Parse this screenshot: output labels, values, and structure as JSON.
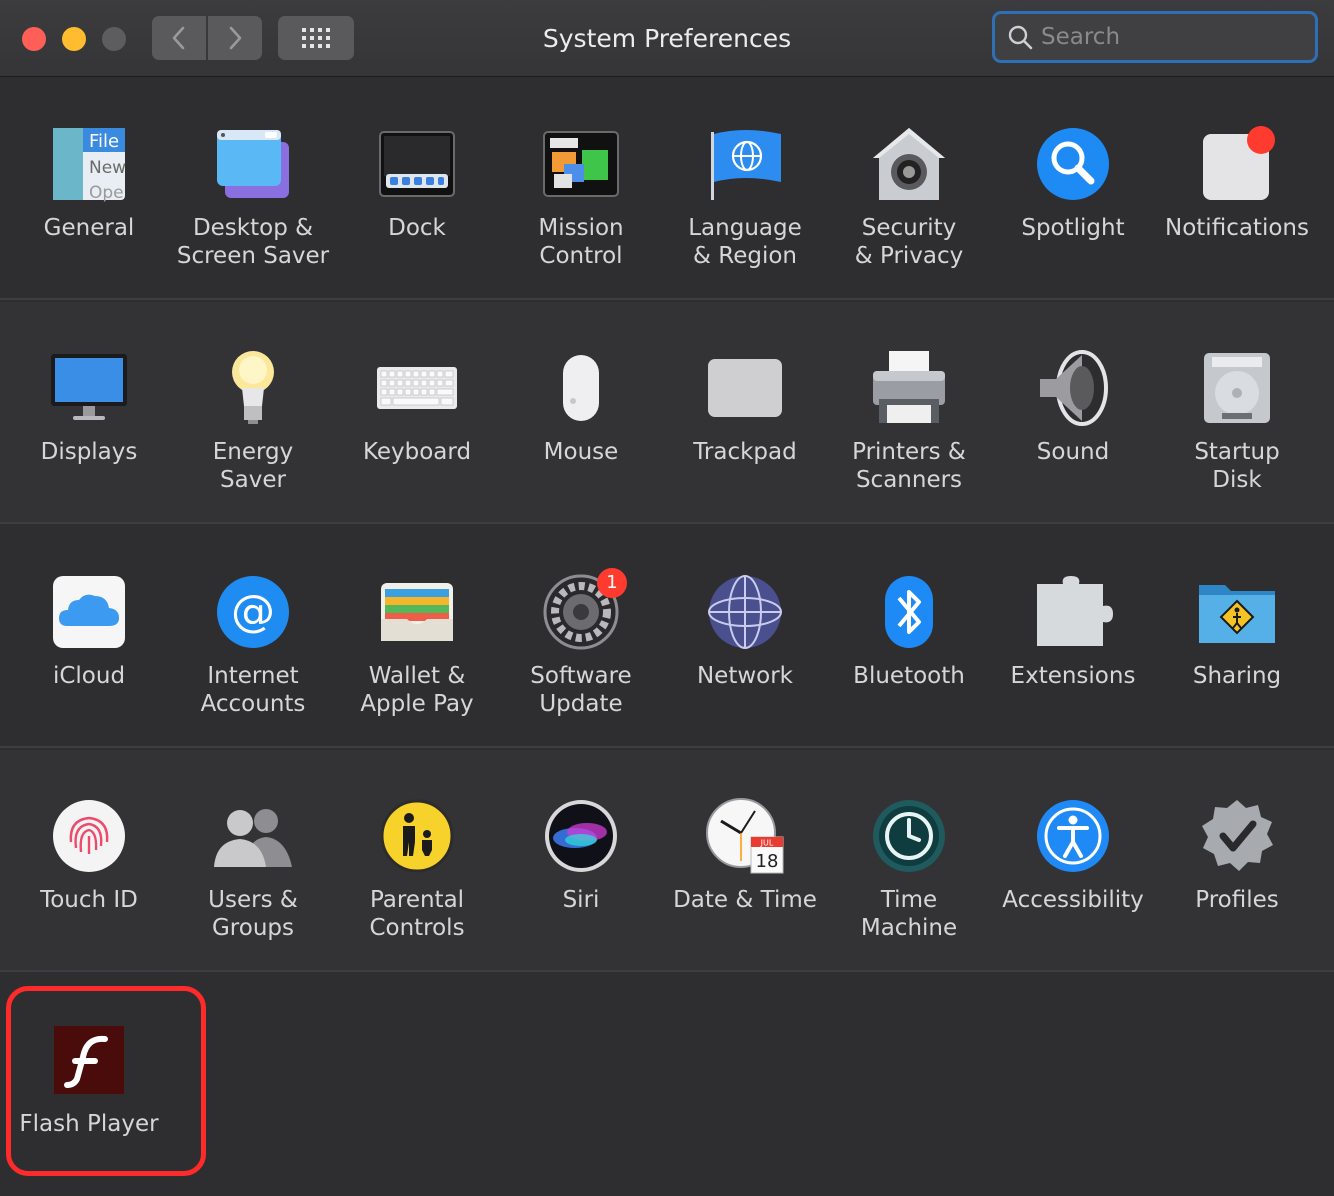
{
  "window": {
    "title": "System Preferences"
  },
  "search": {
    "placeholder": "Search",
    "value": ""
  },
  "toolbar": {
    "back_icon": "chevron-left-icon",
    "forward_icon": "chevron-right-icon",
    "grid_icon": "grid-icon"
  },
  "colors": {
    "close": "#ff5f57",
    "minimize": "#febc2e",
    "zoom": "#5d5d60",
    "highlight": "#ff2a2a",
    "accent": "#2f6fb6"
  },
  "rows": {
    "row1": [
      {
        "label": "General",
        "icon": "general-icon"
      },
      {
        "label": "Desktop &\nScreen Saver",
        "icon": "desktop-icon"
      },
      {
        "label": "Dock",
        "icon": "dock-icon"
      },
      {
        "label": "Mission\nControl",
        "icon": "mission-control-icon"
      },
      {
        "label": "Language\n& Region",
        "icon": "flag-icon"
      },
      {
        "label": "Security\n& Privacy",
        "icon": "house-lock-icon"
      },
      {
        "label": "Spotlight",
        "icon": "magnifier-icon"
      },
      {
        "label": "Notifications",
        "icon": "notifications-icon"
      }
    ],
    "row2": [
      {
        "label": "Displays",
        "icon": "monitor-icon"
      },
      {
        "label": "Energy\nSaver",
        "icon": "lightbulb-icon"
      },
      {
        "label": "Keyboard",
        "icon": "keyboard-icon"
      },
      {
        "label": "Mouse",
        "icon": "mouse-icon"
      },
      {
        "label": "Trackpad",
        "icon": "trackpad-icon"
      },
      {
        "label": "Printers &\nScanners",
        "icon": "printer-icon"
      },
      {
        "label": "Sound",
        "icon": "speaker-icon"
      },
      {
        "label": "Startup\nDisk",
        "icon": "harddisk-icon"
      }
    ],
    "row3": [
      {
        "label": "iCloud",
        "icon": "cloud-icon"
      },
      {
        "label": "Internet\nAccounts",
        "icon": "at-icon"
      },
      {
        "label": "Wallet &\nApple Pay",
        "icon": "wallet-icon"
      },
      {
        "label": "Software\nUpdate",
        "icon": "gear-icon",
        "badge": "1"
      },
      {
        "label": "Network",
        "icon": "globe-icon"
      },
      {
        "label": "Bluetooth",
        "icon": "bluetooth-icon"
      },
      {
        "label": "Extensions",
        "icon": "puzzle-icon"
      },
      {
        "label": "Sharing",
        "icon": "folder-sharing-icon"
      }
    ],
    "row4": [
      {
        "label": "Touch ID",
        "icon": "fingerprint-icon"
      },
      {
        "label": "Users &\nGroups",
        "icon": "users-icon"
      },
      {
        "label": "Parental\nControls",
        "icon": "parental-icon"
      },
      {
        "label": "Siri",
        "icon": "siri-icon"
      },
      {
        "label": "Date & Time",
        "icon": "clock-calendar-icon",
        "calendar_month": "JUL",
        "calendar_day": "18"
      },
      {
        "label": "Time\nMachine",
        "icon": "time-machine-icon"
      },
      {
        "label": "Accessibility",
        "icon": "accessibility-icon"
      },
      {
        "label": "Profiles",
        "icon": "checkmark-badge-icon"
      }
    ],
    "row5": [
      {
        "label": "Flash Player",
        "icon": "flash-icon"
      }
    ]
  }
}
